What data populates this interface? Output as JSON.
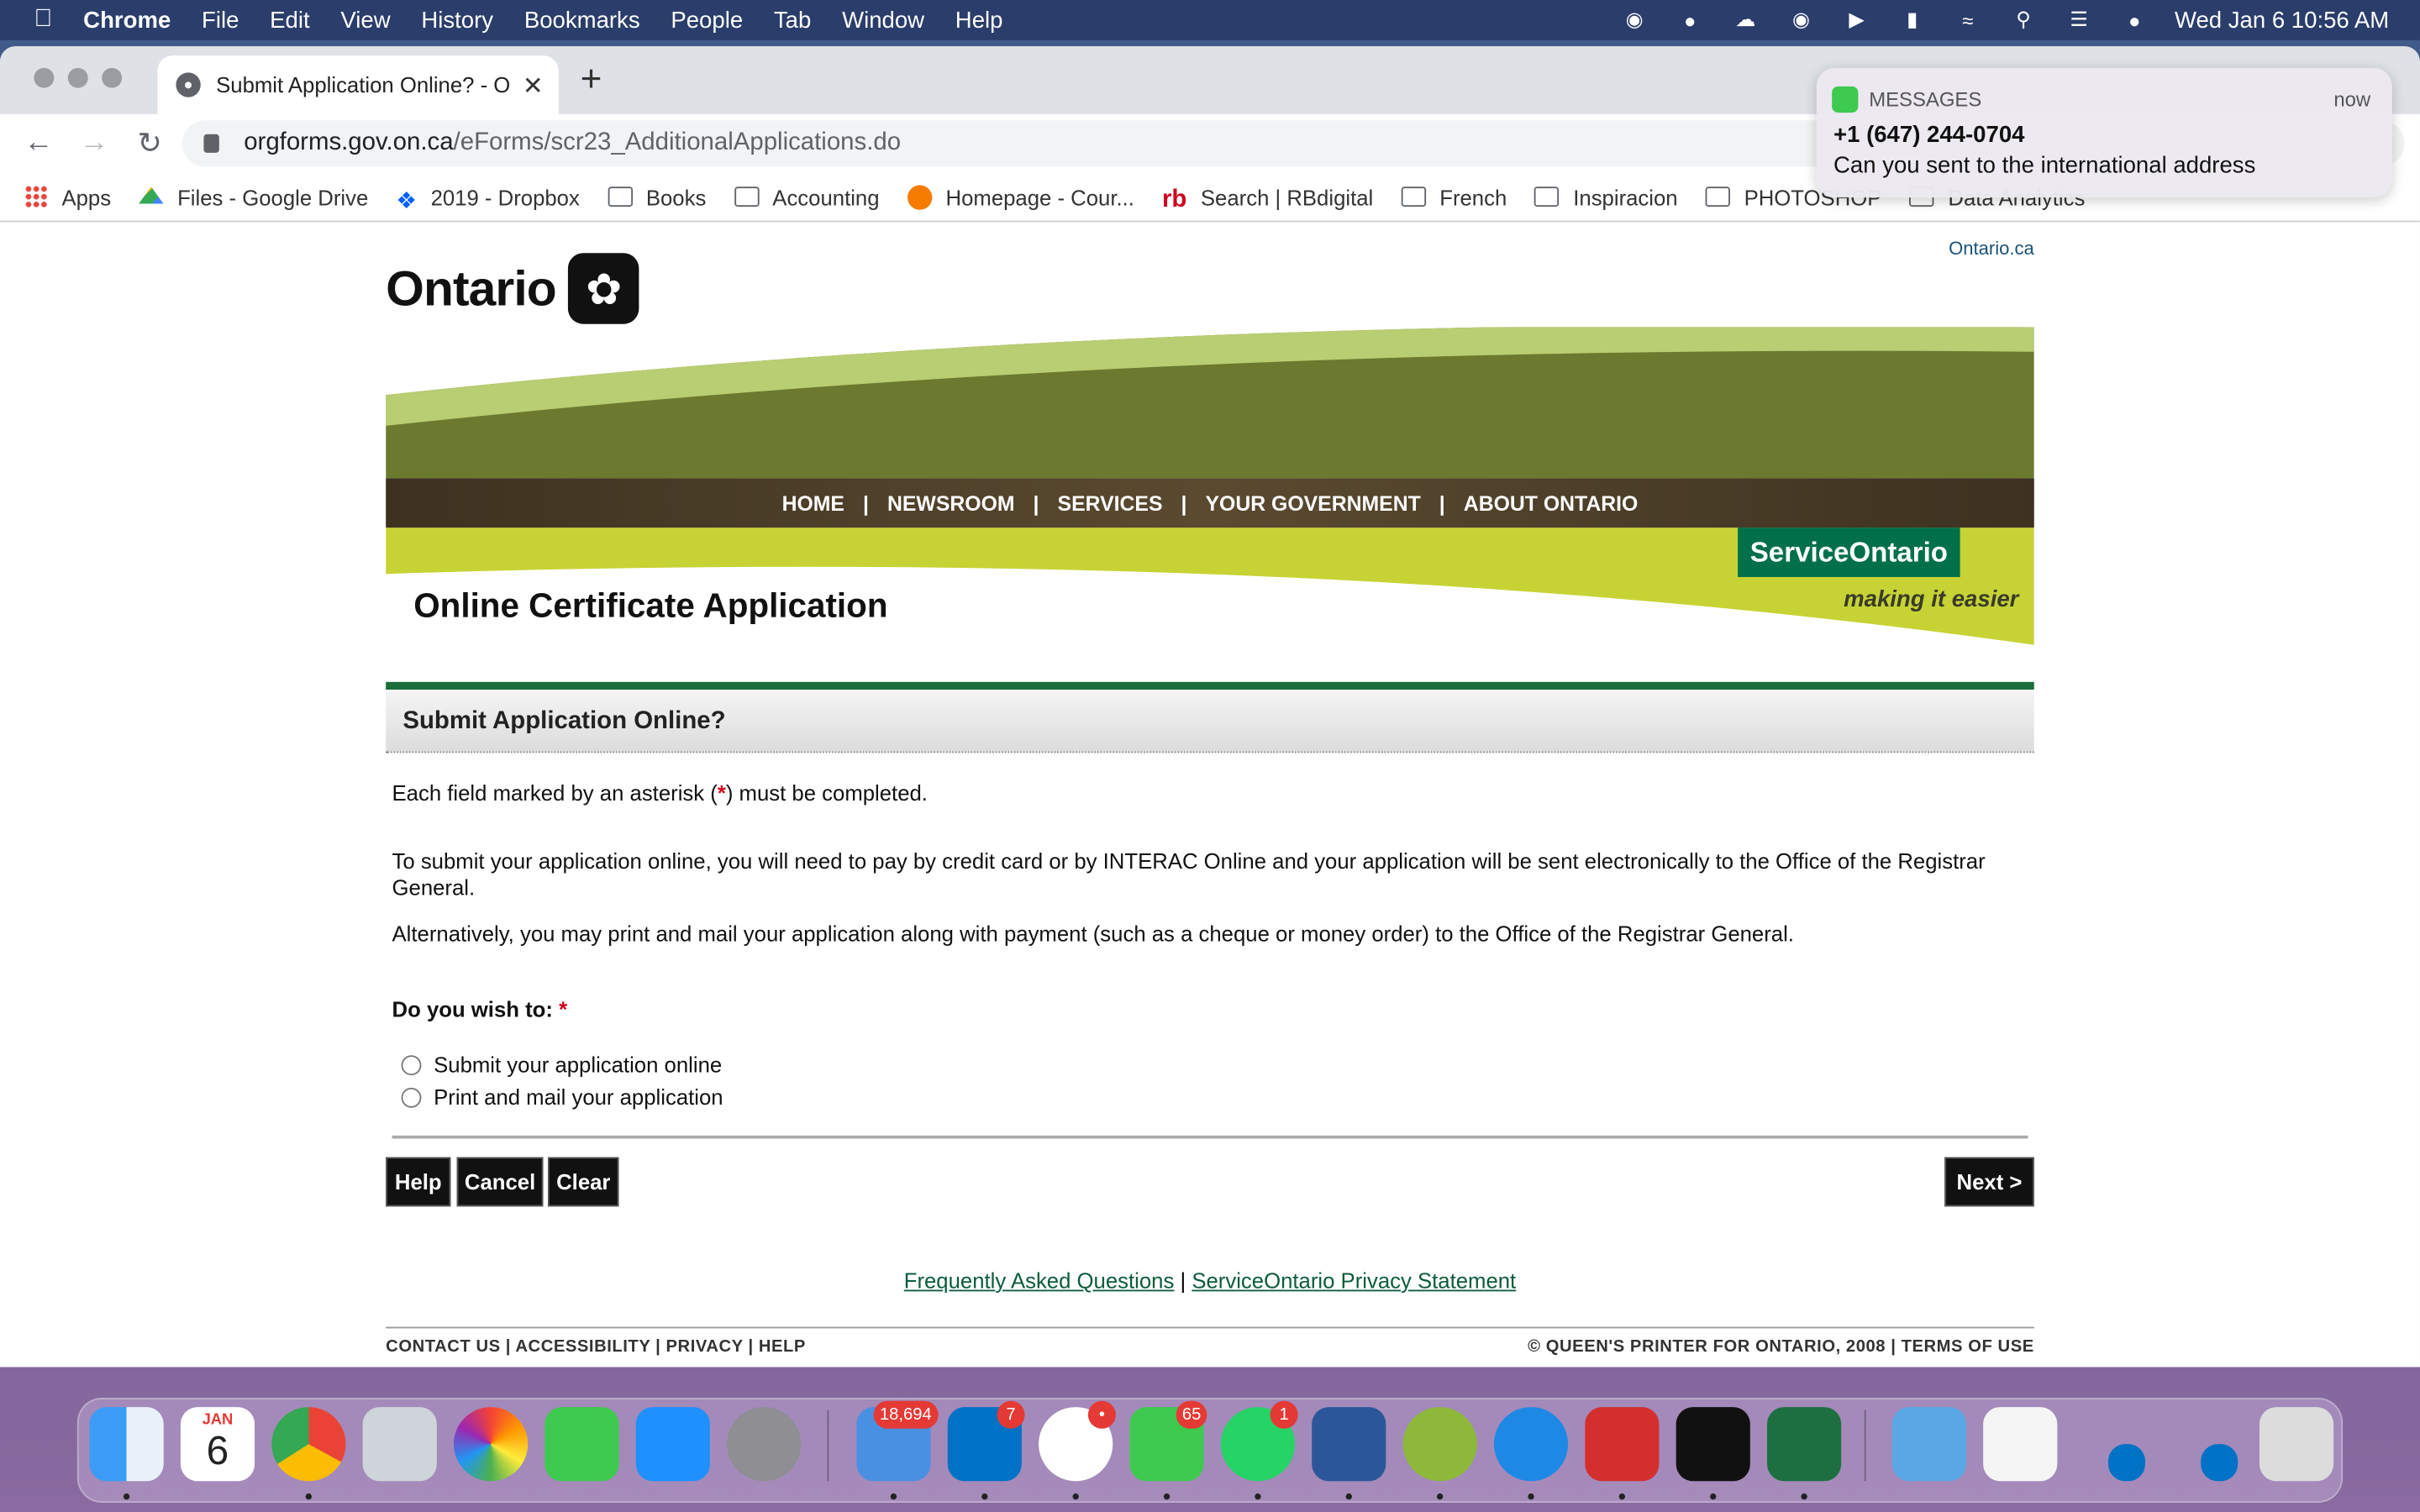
{
  "menubar": {
    "app": "Chrome",
    "items": [
      "File",
      "Edit",
      "View",
      "History",
      "Bookmarks",
      "People",
      "Tab",
      "Window",
      "Help"
    ],
    "clock": "Wed Jan 6  10:56 AM"
  },
  "browser": {
    "tab_title": "Submit Application Online? - O",
    "url_domain": "orgforms.gov.on.ca",
    "url_path": "/eForms/scr23_AdditionalApplications.do",
    "bookmarks": [
      "Apps",
      "Files - Google Drive",
      "2019 - Dropbox",
      "Books",
      "Accounting",
      "Homepage - Cour...",
      "Search | RBdigital",
      "French",
      "Inspiracion",
      "PHOTOSHOP",
      "Data Analytics"
    ]
  },
  "notification": {
    "app": "MESSAGES",
    "time": "now",
    "sender": "+1 (647) 244-0704",
    "message": "Can you sent to the international address"
  },
  "page": {
    "top_link": "Ontario.ca",
    "logo_text": "Ontario",
    "nav": [
      "HOME",
      "NEWSROOM",
      "SERVICES",
      "YOUR GOVERNMENT",
      "ABOUT ONTARIO"
    ],
    "title": "Online Certificate Application",
    "service_badge": "ServiceOntario",
    "tagline": "making it easier",
    "section_header": "Submit Application Online?",
    "asterisk_note_pre": "Each field marked by an asterisk (",
    "asterisk_note_post": ") must be completed.",
    "para_online": "To submit your application online, you will need to pay by credit card or by INTERAC Online and your application will be sent electronically to the Office of the Registrar General.",
    "para_mail": "Alternatively, you may print and mail your application along with payment (such as a cheque or money order) to the Office of the Registrar General.",
    "question": "Do you wish to:",
    "options": [
      "Submit your application online",
      "Print and mail your application"
    ],
    "buttons": {
      "help": "Help",
      "cancel": "Cancel",
      "clear": "Clear",
      "next": "Next  >"
    },
    "footer_links": {
      "faq": "Frequently Asked Questions",
      "sep": "|",
      "privacy": "ServiceOntario Privacy Statement"
    },
    "footer_left": "CONTACT US | ACCESSIBILITY | PRIVACY | HELP",
    "footer_right": "© QUEEN'S PRINTER FOR ONTARIO, 2008 | TERMS OF USE"
  },
  "dock": {
    "calendar_month": "JAN",
    "calendar_day": "6",
    "badges": {
      "mail": "18,694",
      "outlook": "7",
      "slack": "•",
      "messages": "65",
      "whatsapp": "1"
    }
  },
  "colors": {
    "ontario_green": "#1b6e3a",
    "service_green": "#00704a",
    "nav_brown": "#4a3c28",
    "lime": "#c7d334",
    "olive": "#6b7a2e"
  }
}
